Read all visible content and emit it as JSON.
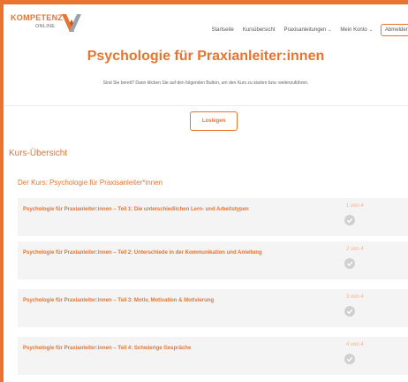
{
  "logo": {
    "top": "KOMPETENZ",
    "sub": "ONLINE"
  },
  "nav": {
    "items": [
      {
        "label": "Startseite",
        "dropdown": false
      },
      {
        "label": "Kursübersicht",
        "dropdown": false
      },
      {
        "label": "Praxisanleitungen",
        "dropdown": true
      },
      {
        "label": "Mein Konto",
        "dropdown": true
      }
    ],
    "logout": "Abmelden",
    "chevron": "⌄"
  },
  "hero": {
    "title": "Psychologie für Praxianleiter:innen",
    "text": "Sind Sie bereit? Dann klicken Sie auf den folgenden Button, um den Kurs zu starten bzw. weiterzuführen."
  },
  "start_button": "Loslegen",
  "overview_title": "Kurs-Übersicht",
  "course_title": "Der Kurs: Psychologie für Praxisanleiter*innen",
  "lessons": [
    {
      "label": "Psychologie für Praxianleiter:innen – Teil 1: Die unterschiedlichen Lern- und Arbeitstypen",
      "count": "1 von 4"
    },
    {
      "label": "Psychologie für Praxianleiter:innen – Teil 2: Unterschiede in der Kommunikation und Anleitung",
      "count": "2 von 4"
    },
    {
      "label": "Psychologie für Praxianleiter:innen – Teil 3: Motiv, Motivation & Motivierung",
      "count": "3 von 4"
    },
    {
      "label": "Psychologie für Praxianleiter:innen – Teil 4: Schwierige Gespräche",
      "count": "4 von 4"
    }
  ],
  "colors": {
    "accent": "#e8742f",
    "logo_x_dark": "#9aa3ab",
    "check_bg": "#d0d0d0"
  },
  "icons": {
    "check": "check-circle-icon",
    "logo": "x-logo-icon",
    "chevron": "chevron-down-icon"
  }
}
